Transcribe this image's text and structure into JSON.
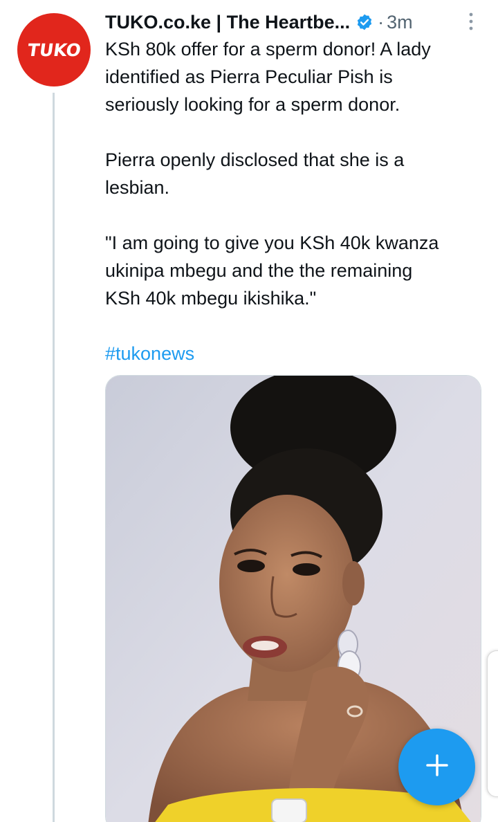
{
  "tweet": {
    "avatar_text": "TUKO",
    "display_name": "TUKO.co.ke | The Heartbe...",
    "separator": "·",
    "time": "3m",
    "paragraph_1": "KSh 80k offer for a sperm donor! A lady\nidentified as Pierra Peculiar Pish is\nseriously looking for a sperm donor.",
    "paragraph_2": "Pierra openly disclosed that she is a\nlesbian.",
    "paragraph_3": "\"I am going to give you KSh 40k kwanza\nukinipa mbegu and the the remaining\nKSh 40k mbegu ikishika.\"",
    "hashtag": "#tukonews"
  },
  "icons": {
    "verified": "verified-badge-icon",
    "more": "more-vertical-icon",
    "compose": "plus-icon"
  },
  "colors": {
    "avatar_bg": "#e1261c",
    "accent": "#1d9bf0",
    "text_primary": "#0f1419",
    "text_secondary": "#536471",
    "thread_line": "#cfd9de"
  }
}
